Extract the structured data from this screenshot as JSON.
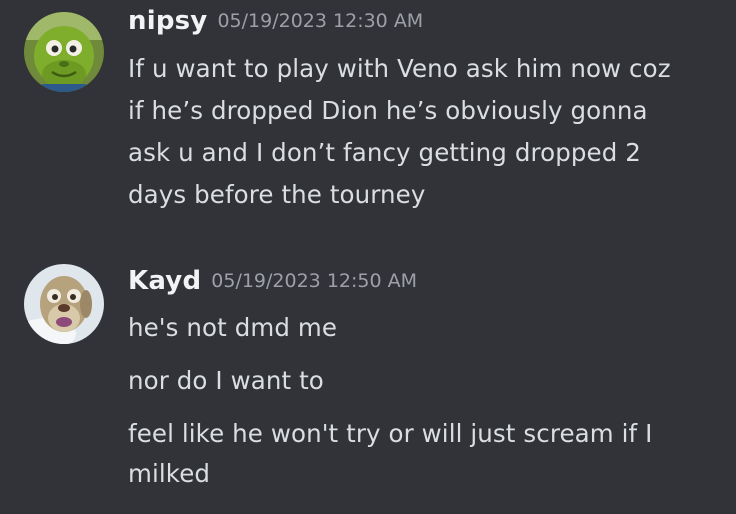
{
  "messages": [
    {
      "username": "nipsy",
      "timestamp": "05/19/2023 12:30 AM",
      "avatar_icon": "green-monster-face-avatar",
      "lines": [
        "If u want to play with Veno ask him now  coz",
        "if he’s dropped Dion he’s obviously gonna",
        "ask u and I don’t fancy getting dropped 2",
        "days before the tourney"
      ]
    },
    {
      "username": "Kayd",
      "timestamp": "05/19/2023 12:50 AM",
      "avatar_icon": "sloth-face-avatar",
      "lines": [
        "he's not dmd me",
        "nor do I want to",
        "feel like he won't try or will just scream if I",
        "milked"
      ]
    }
  ],
  "colors": {
    "background": "#313338",
    "username": "#f2f3f5",
    "timestamp": "#9da0a6",
    "message_text": "#dbdee1"
  }
}
